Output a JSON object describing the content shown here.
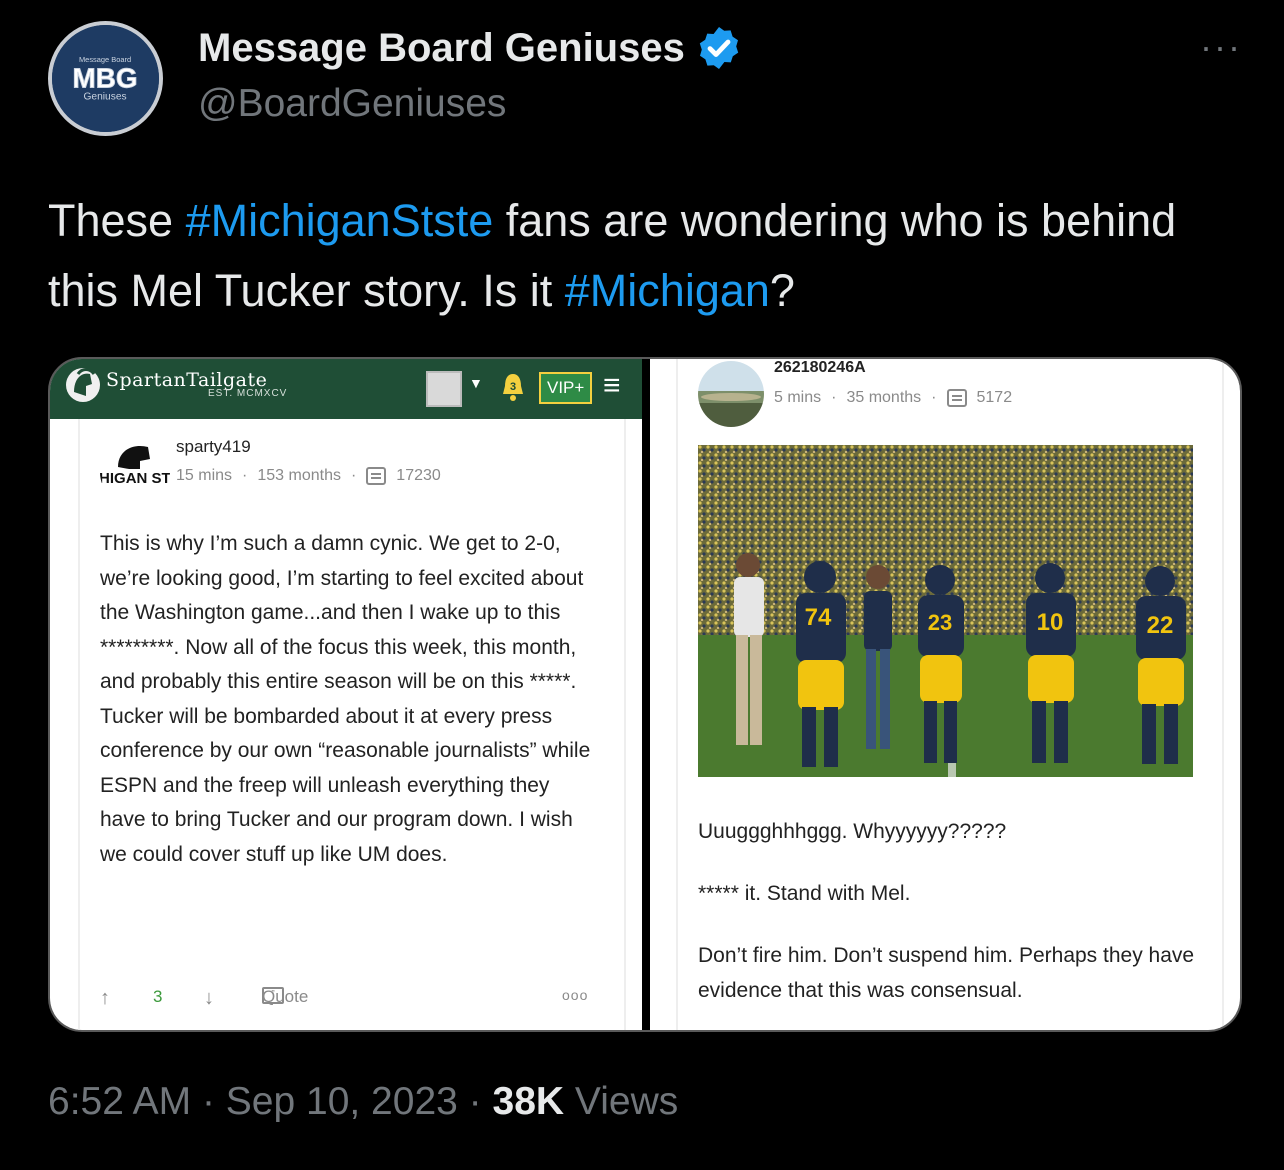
{
  "author": {
    "display_name": "Message Board Geniuses",
    "handle": "@BoardGeniuses",
    "avatar_text_top": "Message Board",
    "avatar_text_main": "MBG",
    "avatar_text_bottom": "Geniuses",
    "verified_icon": "verified-badge-icon",
    "more_label": "···"
  },
  "tweet": {
    "text_1": "These ",
    "hashtag_1": "#MichiganStste",
    "text_2": " fans are wondering who is behind this Mel Tucker story. Is it ",
    "hashtag_2": "#Michigan",
    "text_3": "?"
  },
  "left_screenshot": {
    "site_name": "SpartanTailgate",
    "site_est": "EST. MCMXCV",
    "notification_count": "3",
    "vip_label": "VIP+",
    "post": {
      "username": "sparty419",
      "avatar_text": "MICHIGAN STATE",
      "time": "15 mins",
      "tenure": "153 months",
      "post_count": "17230",
      "body": "This is why I’m such a damn cynic. We get to 2-0, we’re looking good, I’m starting to feel excited about the Washington game...and then I wake up to this *********. Now all of the focus this week, this month, and probably this entire season will be on this *****. Tucker will be bombarded about it at every press conference by our own “reasonable journalists” while ESPN and the freep will unleash everything they have to bring Tucker and our program down. I wish we could cover stuff up like UM does.",
      "upvotes": "3",
      "quote_label": "Quote",
      "more_label": "ooo"
    }
  },
  "right_screenshot": {
    "post": {
      "username": "262180246A",
      "time": "5 mins",
      "tenure": "35 months",
      "post_count": "5172",
      "jersey_numbers": [
        "74",
        "23",
        "10",
        "22"
      ],
      "line_1": "Uuuggghhhggg. Whyyyyyy?????",
      "line_2": "***** it. Stand with Mel.",
      "line_3": "Don’t fire him. Don’t suspend him. Perhaps they have evidence that this was consensual."
    }
  },
  "footer": {
    "time": "6:52 AM",
    "date": "Sep 10, 2023",
    "views_count": "38K",
    "views_label": "Views",
    "separator": "·"
  },
  "colors": {
    "background": "#000000",
    "hashtag": "#1d9bf0",
    "verified": "#1d9bf0",
    "spartan_green": "#1f4e36",
    "muted": "#71767b"
  }
}
